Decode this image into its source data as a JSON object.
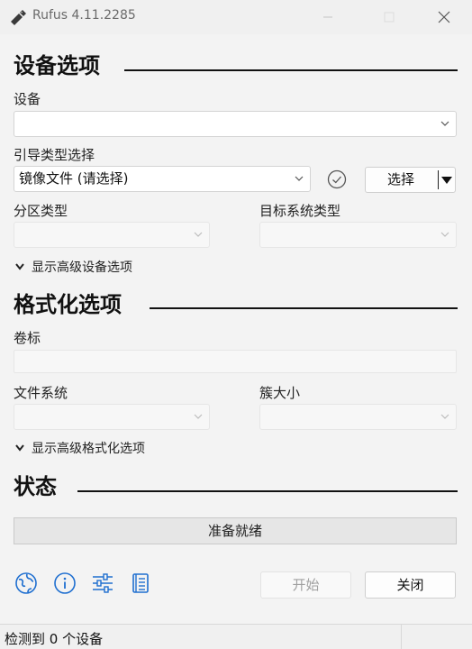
{
  "window": {
    "title": "Rufus 4.11.2285"
  },
  "device_section": {
    "title": "设备选项",
    "device_label": "设备",
    "device_value": "",
    "boot_label": "引导类型选择",
    "boot_value": "镜像文件 (请选择)",
    "select_button": "选择",
    "partition_label": "分区类型",
    "partition_value": "",
    "target_label": "目标系统类型",
    "target_value": "",
    "advanced_toggle": "显示高级设备选项"
  },
  "format_section": {
    "title": "格式化选项",
    "volume_label": "卷标",
    "volume_value": "",
    "fs_label": "文件系统",
    "fs_value": "",
    "cluster_label": "簇大小",
    "cluster_value": "",
    "advanced_toggle": "显示高级格式化选项"
  },
  "status_section": {
    "title": "状态",
    "progress_text": "准备就绪",
    "progress_fraction": 0
  },
  "toolbar": {
    "icons": [
      "globe-icon",
      "info-icon",
      "settings-sliders-icon",
      "log-icon"
    ],
    "start_button": "开始",
    "close_button": "关闭"
  },
  "statusbar": {
    "text": "检测到 0 个设备"
  },
  "colors": {
    "accent_blue": "#1f6fd0",
    "rule": "#111111"
  }
}
